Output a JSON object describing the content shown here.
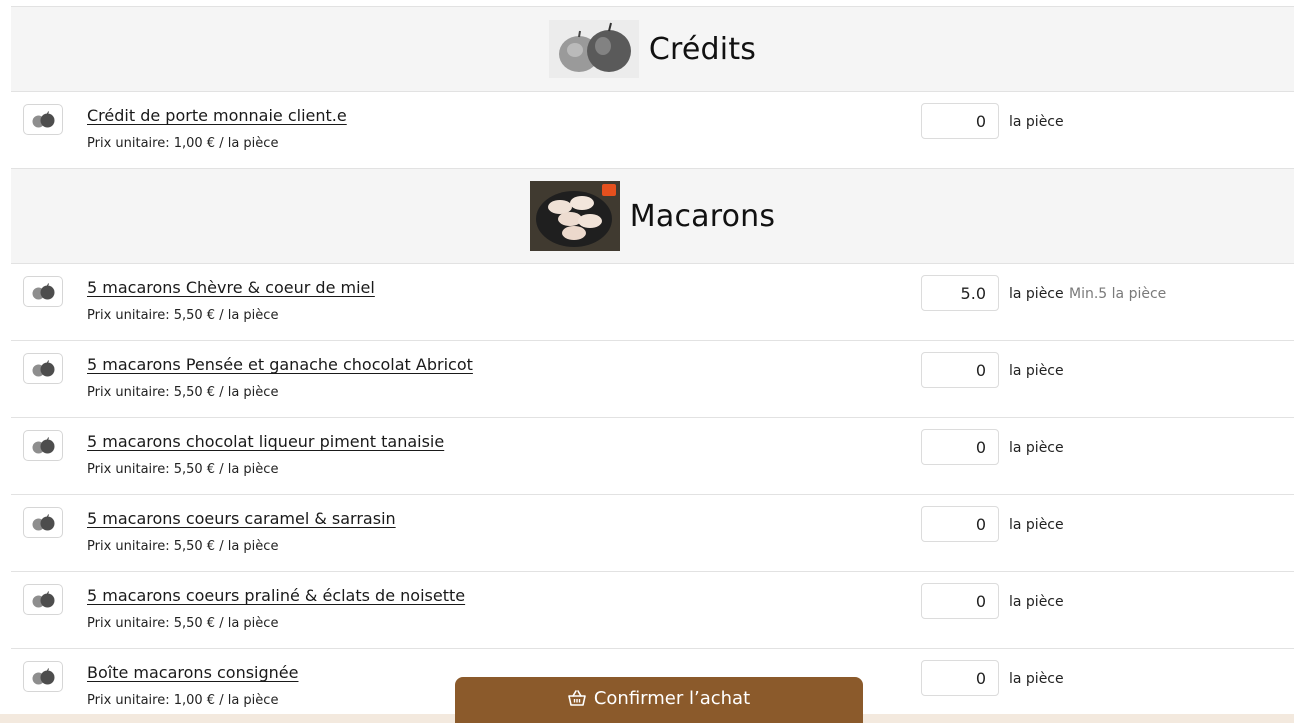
{
  "categories": [
    {
      "title": "Crédits",
      "image_icon": "apples-image",
      "items": [
        {
          "name": "Crédit de porte monnaie client.e",
          "price": "Prix unitaire: 1,00 € / la pièce",
          "qty": "0",
          "unit": "la pièce",
          "min": ""
        }
      ]
    },
    {
      "title": "Macarons",
      "image_icon": "macarons-image",
      "items": [
        {
          "name": "5 macarons Chèvre & coeur de miel",
          "price": "Prix unitaire: 5,50 € / la pièce",
          "qty": "5.0",
          "unit": "la pièce",
          "min": "Min.5 la pièce"
        },
        {
          "name": "5 macarons Pensée et ganache chocolat Abricot",
          "price": "Prix unitaire: 5,50 € / la pièce",
          "qty": "0",
          "unit": "la pièce",
          "min": ""
        },
        {
          "name": "5 macarons chocolat liqueur piment tanaisie",
          "price": "Prix unitaire: 5,50 € / la pièce",
          "qty": "0",
          "unit": "la pièce",
          "min": ""
        },
        {
          "name": "5 macarons coeurs caramel & sarrasin",
          "price": "Prix unitaire: 5,50 € / la pièce",
          "qty": "0",
          "unit": "la pièce",
          "min": ""
        },
        {
          "name": "5 macarons coeurs praliné & éclats de noisette",
          "price": "Prix unitaire: 5,50 € / la pièce",
          "qty": "0",
          "unit": "la pièce",
          "min": ""
        },
        {
          "name": "Boîte macarons consignée",
          "price": "Prix unitaire: 1,00 € / la pièce",
          "qty": "0",
          "unit": "la pièce",
          "min": ""
        }
      ]
    }
  ],
  "footer": {
    "confirm_label": "Confirmer l’achat",
    "confirm_icon": "basket-icon"
  },
  "colors": {
    "accent": "#8b5a2b",
    "section_bg": "#f5f5f5",
    "bottom_bar": "#f3e9de"
  }
}
